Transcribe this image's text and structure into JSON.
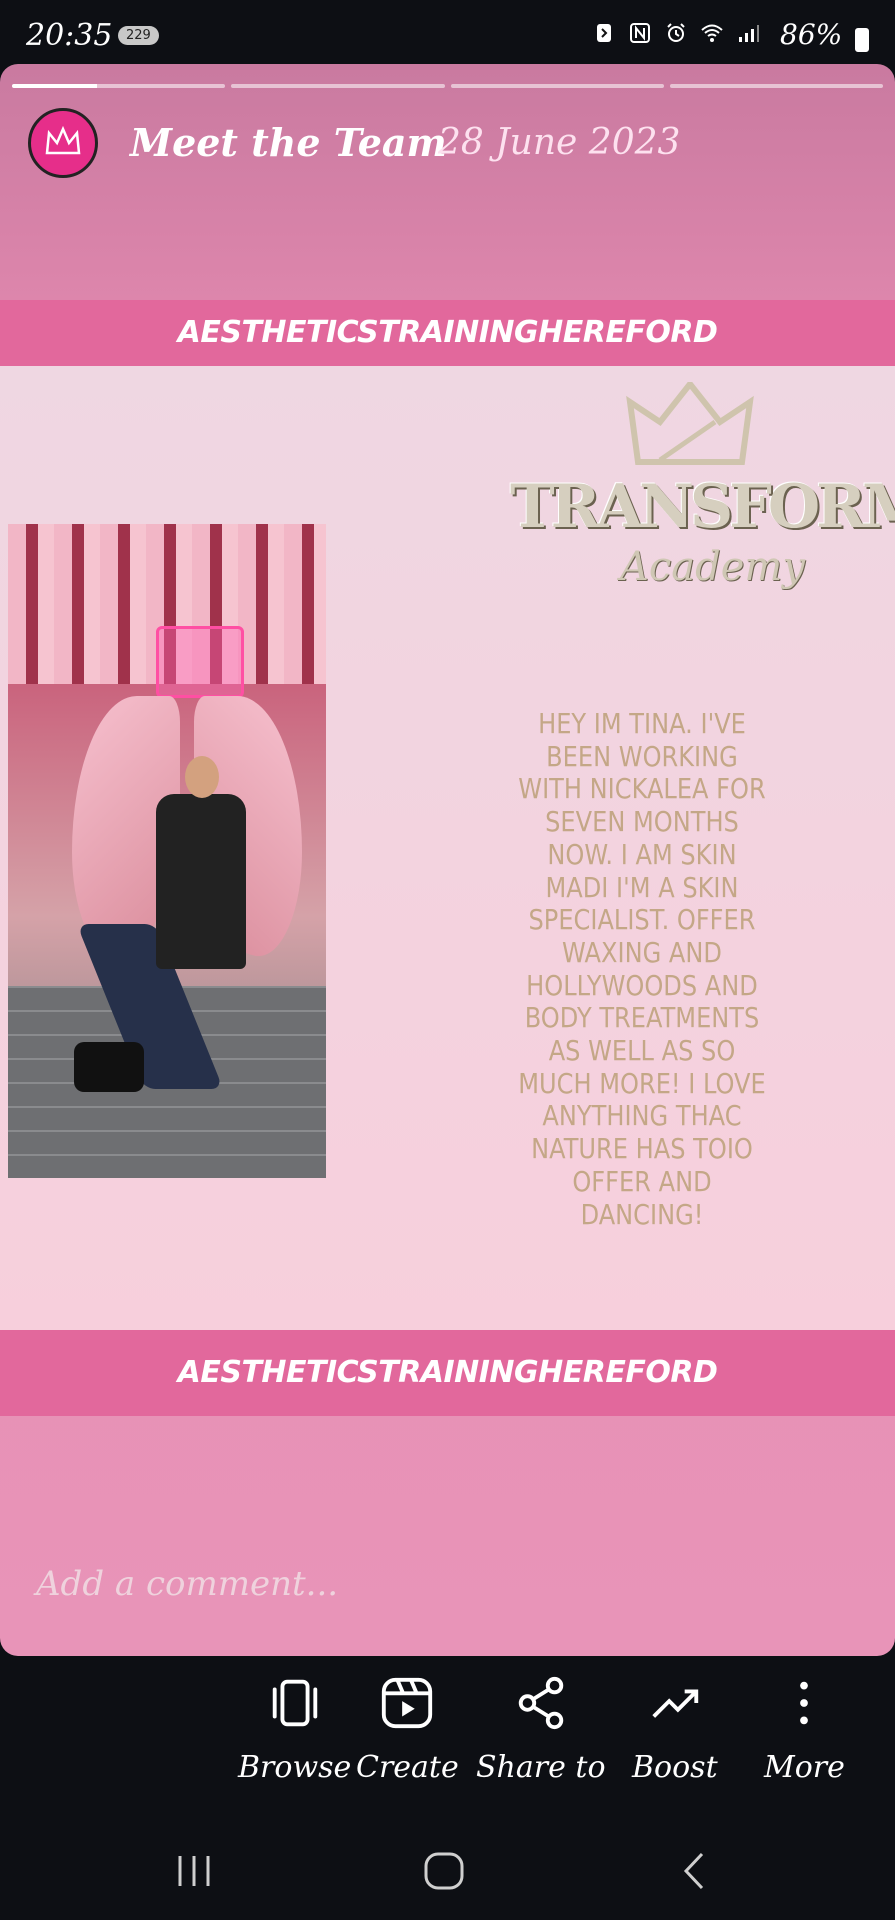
{
  "status_bar": {
    "time": "20:35",
    "badge": "229",
    "battery": "86%"
  },
  "story": {
    "title": "Meet the Team",
    "date": "28 June 2023",
    "banner_top": "AESTHETICSTRAININGHEREFORD",
    "banner_bottom": "AESTHETICSTRAININGHEREFORD",
    "logo_word": "TRANSFORMED",
    "logo_script": "Academy",
    "bio": "HEY IM TINA. I'VE BEEN WORKING WITH NICKALEA FOR SEVEN MONTHS NOW. I AM SKIN MADI I'M A SKIN SPECIALIST. OFFER WAXING AND HOLLYWOODS AND BODY TREATMENTS AS WELL AS SO MUCH MORE! I LOVE ANYTHING THAC NATURE HAS TOIO OFFER AND DANCING!",
    "comment_placeholder": "Add a comment..."
  },
  "actions": [
    {
      "label": "Browse",
      "icon": "browse-icon"
    },
    {
      "label": "Create",
      "icon": "create-icon"
    },
    {
      "label": "Share to",
      "icon": "share-icon"
    },
    {
      "label": "Boost",
      "icon": "boost-icon"
    },
    {
      "label": "More",
      "icon": "more-icon"
    }
  ],
  "colors": {
    "banner": "#e2689c",
    "bio_text": "#c4a787",
    "avatar": "#e62e8a"
  }
}
